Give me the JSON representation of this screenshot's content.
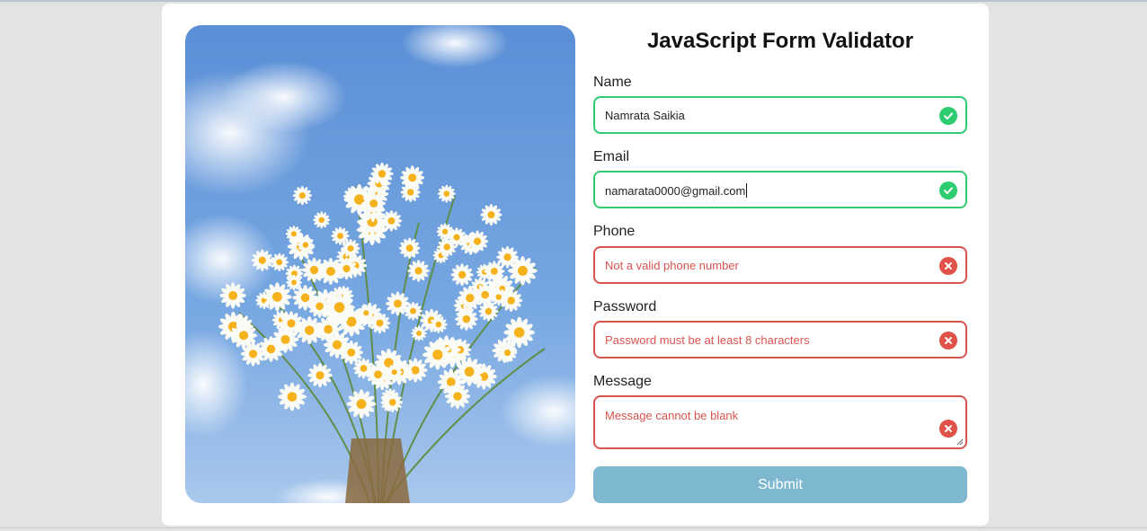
{
  "form": {
    "title": "JavaScript Form Validator",
    "fields": [
      {
        "label": "Name",
        "value": "Namrata Saikia",
        "status": "success"
      },
      {
        "label": "Email",
        "value": "namarata0000@gmail.com",
        "status": "success"
      },
      {
        "label": "Phone",
        "value": "Not a valid phone number",
        "status": "error"
      },
      {
        "label": "Password",
        "value": "Password must be at least 8 characters",
        "status": "error"
      },
      {
        "label": "Message",
        "value": "Message cannot be blank",
        "status": "error"
      }
    ],
    "submit_label": "Submit"
  },
  "colors": {
    "success": "#2ecc71",
    "error": "#d9534f",
    "submit": "#7db8d0"
  },
  "icons": {
    "success": "check-circle-icon",
    "error": "x-circle-icon"
  }
}
